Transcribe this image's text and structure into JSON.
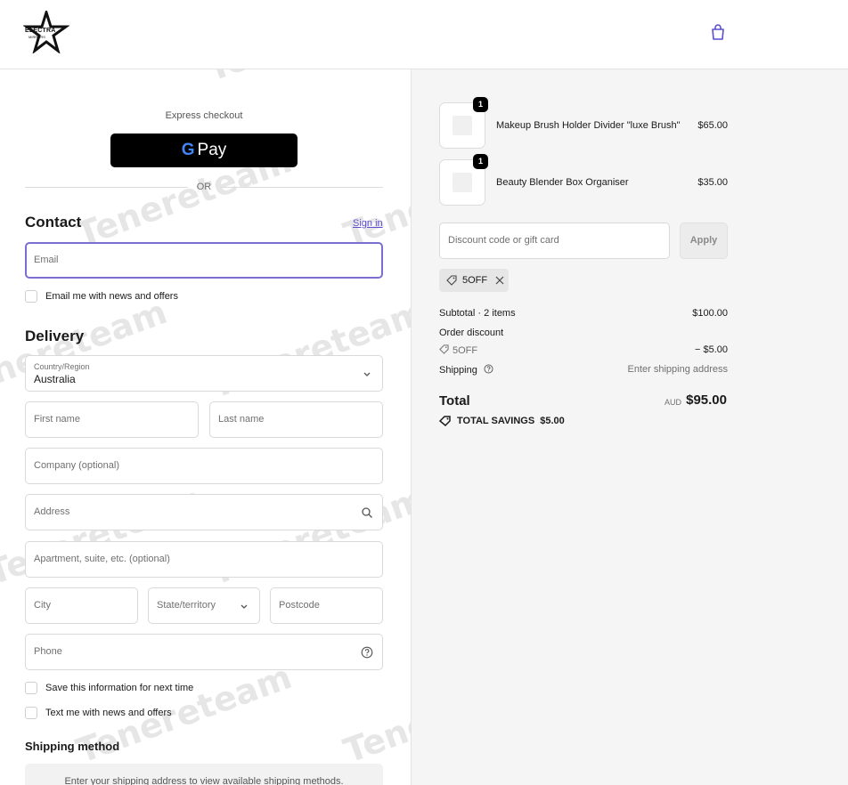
{
  "brand": {
    "name": "ELECTRA",
    "sub": "MIRRORS"
  },
  "express": {
    "label": "Express checkout",
    "gpay_g": "G",
    "gpay_text": "Pay"
  },
  "divider": "OR",
  "contact": {
    "heading": "Contact",
    "sign_in": "Sign in",
    "email_placeholder": "Email",
    "news_label": "Email me with news and offers"
  },
  "delivery": {
    "heading": "Delivery",
    "country_label": "Country/Region",
    "country_value": "Australia",
    "first_name": "First name",
    "last_name": "Last name",
    "company": "Company (optional)",
    "address": "Address",
    "apartment": "Apartment, suite, etc. (optional)",
    "city": "City",
    "state": "State/territory",
    "postcode": "Postcode",
    "phone": "Phone",
    "save_info": "Save this information for next time",
    "text_news": "Text me with news and offers"
  },
  "shipping_method": {
    "heading": "Shipping method",
    "notice": "Enter your shipping address to view available shipping methods."
  },
  "cart": {
    "items": [
      {
        "name": "Makeup Brush Holder Divider \"luxe Brush\"",
        "price": "$65.00",
        "qty": "1"
      },
      {
        "name": "Beauty Blender Box Organiser",
        "price": "$35.00",
        "qty": "1"
      }
    ],
    "discount_placeholder": "Discount code or gift card",
    "apply_label": "Apply",
    "applied_code": "5OFF"
  },
  "summary": {
    "subtotal_label": "Subtotal · 2 items",
    "subtotal_value": "$100.00",
    "order_discount_label": "Order discount",
    "discount_code": "5OFF",
    "discount_value": "− $5.00",
    "shipping_label": "Shipping",
    "shipping_value": "Enter shipping address",
    "total_label": "Total",
    "currency": "AUD",
    "total_value": "$95.00",
    "savings_label": "TOTAL SAVINGS",
    "savings_value": "$5.00"
  },
  "watermark": "Tenereteam"
}
